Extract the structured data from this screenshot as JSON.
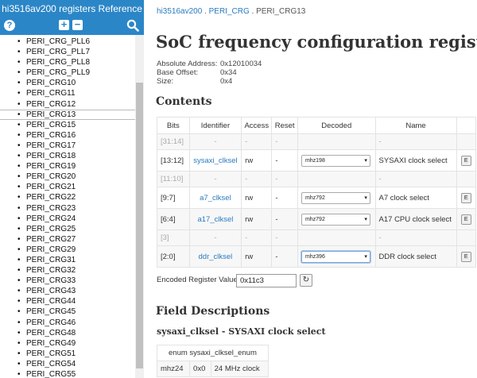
{
  "sidebar": {
    "title": "hi3516av200 registers Reference",
    "help_glyph": "?",
    "expand_glyph": "+",
    "collapse_glyph": "−",
    "items": [
      "PERI_CRG_PLL6",
      "PERI_CRG_PLL7",
      "PERI_CRG_PLL8",
      "PERI_CRG_PLL9",
      "PERI_CRG10",
      "PERI_CRG11",
      "PERI_CRG12",
      "PERI_CRG13",
      "PERI_CRG15",
      "PERI_CRG16",
      "PERI_CRG17",
      "PERI_CRG18",
      "PERI_CRG19",
      "PERI_CRG20",
      "PERI_CRG21",
      "PERI_CRG22",
      "PERI_CRG23",
      "PERI_CRG24",
      "PERI_CRG25",
      "PERI_CRG27",
      "PERI_CRG29",
      "PERI_CRG31",
      "PERI_CRG32",
      "PERI_CRG33",
      "PERI_CRG43",
      "PERI_CRG44",
      "PERI_CRG45",
      "PERI_CRG46",
      "PERI_CRG48",
      "PERI_CRG49",
      "PERI_CRG51",
      "PERI_CRG54",
      "PERI_CRG55"
    ],
    "active_index": 7
  },
  "breadcrumb": {
    "part1": "hi3516av200",
    "sep": " . ",
    "part2": "PERI_CRG",
    "part3": "PERI_CRG13"
  },
  "page": {
    "title": "SoC frequency configuration register",
    "abs_label": "Absolute Address:",
    "abs_value": "0x12010034",
    "base_label": "Base Offset:",
    "base_value": "0x34",
    "size_label": "Size:",
    "size_value": "0x4",
    "contents_heading": "Contents"
  },
  "table": {
    "headers": [
      "Bits",
      "Identifier",
      "Access",
      "Reset",
      "Decoded",
      "Name",
      ""
    ],
    "rows": [
      {
        "bits": "[31:14]",
        "id": "-",
        "access": "-",
        "reset": "-",
        "decoded": "",
        "name": "-",
        "reserved": true
      },
      {
        "bits": "[13:12]",
        "id": "sysaxi_clksel",
        "access": "rw",
        "reset": "-",
        "decoded": "mhz198",
        "name": "SYSAXI clock select",
        "reserved": false
      },
      {
        "bits": "[11:10]",
        "id": "-",
        "access": "-",
        "reset": "-",
        "decoded": "",
        "name": "-",
        "reserved": true
      },
      {
        "bits": "[9:7]",
        "id": "a7_clksel",
        "access": "rw",
        "reset": "-",
        "decoded": "mhz792",
        "name": "A7 clock select",
        "reserved": false
      },
      {
        "bits": "[6:4]",
        "id": "a17_clksel",
        "access": "rw",
        "reset": "-",
        "decoded": "mhz792",
        "name": "A17 CPU clock select",
        "reserved": false
      },
      {
        "bits": "[3]",
        "id": "-",
        "access": "-",
        "reset": "-",
        "decoded": "",
        "name": "-",
        "reserved": true
      },
      {
        "bits": "[2:0]",
        "id": "ddr_clksel",
        "access": "rw",
        "reset": "-",
        "decoded": "mhz396",
        "name": "DDR clock select",
        "reserved": false
      }
    ],
    "edit_label": "E",
    "select_arrow": "▾"
  },
  "encoded": {
    "label": "Encoded Register Value:",
    "value": "0x11c3",
    "reset_glyph": "↻"
  },
  "fields": {
    "heading": "Field Descriptions",
    "sub_heading": "sysaxi_clksel - SYSAXI clock select",
    "enum_header": "enum sysaxi_clksel_enum",
    "enum_rows": [
      {
        "name": "mhz24",
        "value": "0x0",
        "desc": "24 MHz clock"
      }
    ]
  },
  "colors": {
    "header_blue": "#2b86c7",
    "link_blue": "#2b7bbf",
    "sidebar_dark": "#2b2b2b"
  }
}
